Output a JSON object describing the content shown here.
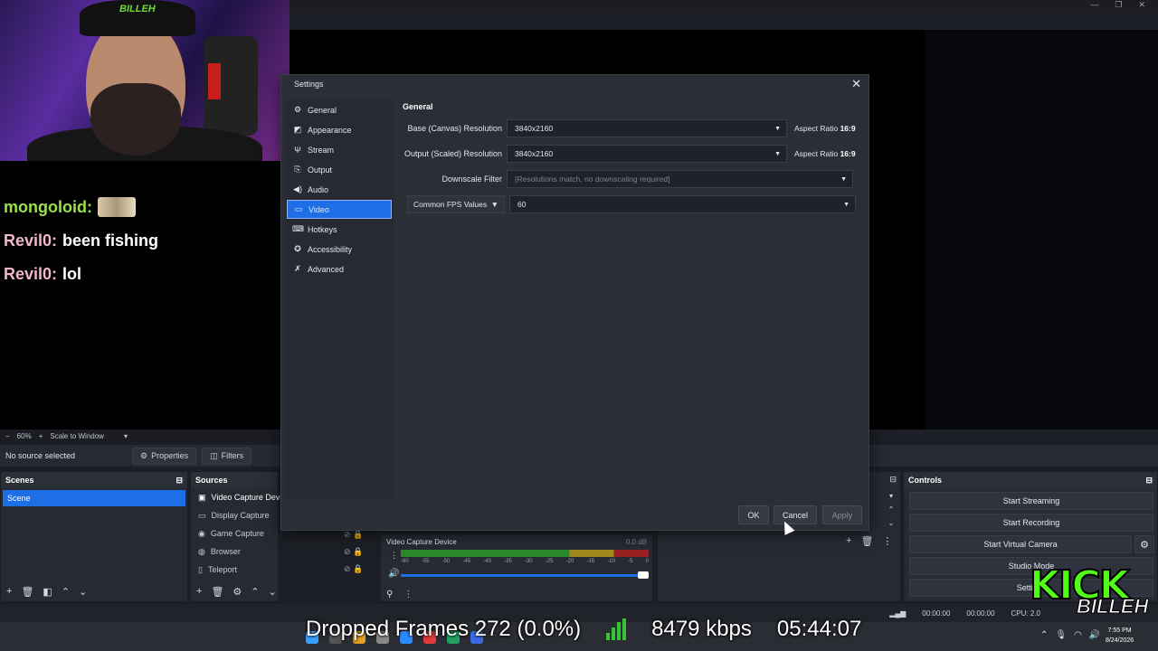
{
  "chat": [
    {
      "user": "mongoloid:",
      "message": "",
      "emote": true
    },
    {
      "user": "Revil0:",
      "message": "been fishing"
    },
    {
      "user": "Revil0:",
      "message": "lol"
    }
  ],
  "zoom": {
    "minus": "−",
    "level": "60%",
    "plus": "+",
    "mode": "Scale to Window"
  },
  "source_bar": {
    "no_source": "No source selected",
    "properties": "Properties",
    "filters": "Filters"
  },
  "scenes": {
    "title": "Scenes",
    "items": [
      "Scene"
    ]
  },
  "sources": {
    "title": "Sources",
    "items": [
      "Video Capture Dev",
      "Display Capture",
      "Game Capture",
      "Browser",
      "Teleport"
    ]
  },
  "mixer": {
    "name": "Video Capture Device",
    "db": "0.0 dB",
    "ticks": [
      "-60",
      "-55",
      "-50",
      "-45",
      "-40",
      "-35",
      "-30",
      "-25",
      "-20",
      "-15",
      "-10",
      "-5",
      "0"
    ],
    "volume": 1.0
  },
  "controls": {
    "title": "Controls",
    "start_streaming": "Start Streaming",
    "start_recording": "Start Recording",
    "start_virtual_camera": "Start Virtual Camera",
    "studio_mode": "Studio Mode",
    "settings": "Settings"
  },
  "status": {
    "stream_time": "00:00:00",
    "rec_time": "00:00:00",
    "cpu": "CPU: 2.0"
  },
  "overlay": {
    "dropped_frames": "Dropped Frames 272 (0.0%)",
    "kbps": "8479 kbps",
    "uptime": "05:44:07"
  },
  "clock": {
    "time": "7:55 PM",
    "date": "8/24/2026"
  },
  "kick": {
    "title": "KICK",
    "sub": "BILLEH"
  },
  "webcam": {
    "cap_text": "BILLEH"
  },
  "dialog": {
    "title": "Settings",
    "nav": [
      {
        "label": "General",
        "icon": "gear-icon"
      },
      {
        "label": "Appearance",
        "icon": "palette-icon"
      },
      {
        "label": "Stream",
        "icon": "antenna-icon"
      },
      {
        "label": "Output",
        "icon": "output-icon"
      },
      {
        "label": "Audio",
        "icon": "speaker-icon"
      },
      {
        "label": "Video",
        "icon": "monitor-icon",
        "active": true
      },
      {
        "label": "Hotkeys",
        "icon": "keyboard-icon"
      },
      {
        "label": "Accessibility",
        "icon": "accessibility-icon"
      },
      {
        "label": "Advanced",
        "icon": "wrench-icon"
      }
    ],
    "section": "General",
    "base_label": "Base (Canvas) Resolution",
    "base_value": "3840x2160",
    "output_label": "Output (Scaled) Resolution",
    "output_value": "3840x2160",
    "aspect_prefix": "Aspect Ratio",
    "aspect_value": "16:9",
    "downscale_label": "Downscale Filter",
    "downscale_value": "[Resolutions match, no downscaling required]",
    "fps_type": "Common FPS Values",
    "fps_value": "60",
    "ok": "OK",
    "cancel": "Cancel",
    "apply": "Apply"
  },
  "colors": {
    "accent": "#1e6fe6",
    "kick_green": "#53fc18"
  }
}
